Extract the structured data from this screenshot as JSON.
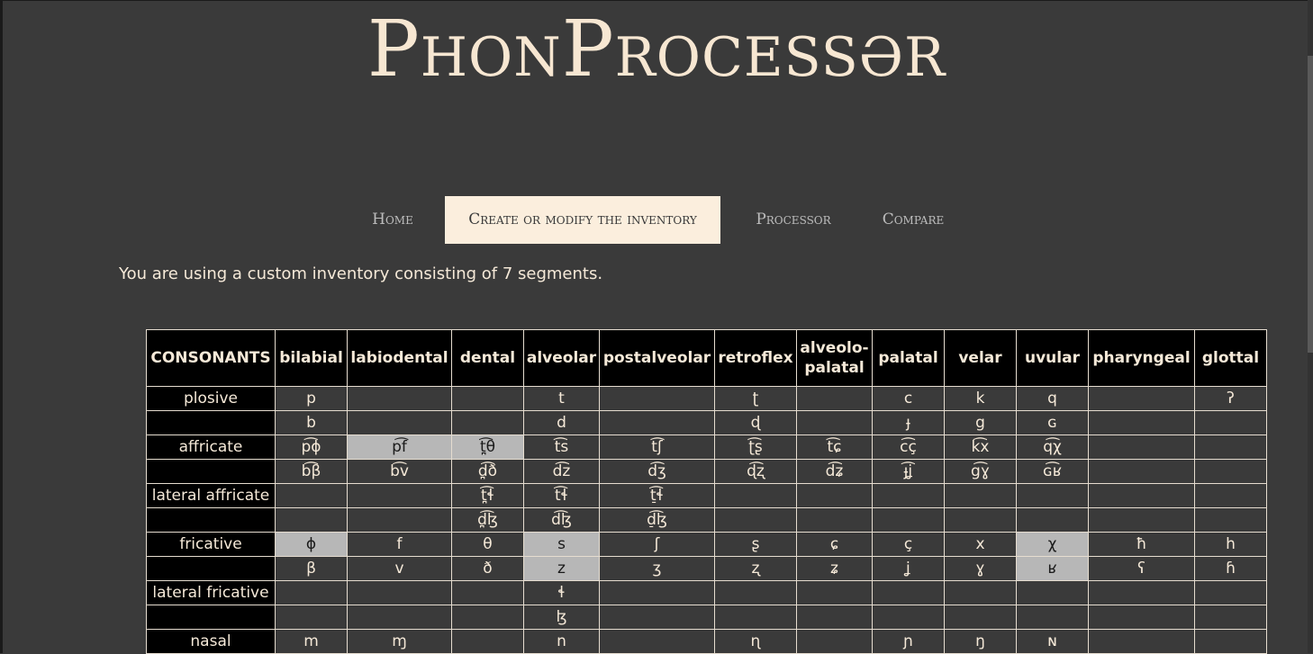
{
  "app": {
    "title": "PhonProcessər"
  },
  "nav": {
    "items": [
      {
        "label": "Home",
        "active": false
      },
      {
        "label": "Create or modify the inventory",
        "active": true
      },
      {
        "label": "Processor",
        "active": false
      },
      {
        "label": "Compare",
        "active": false
      }
    ]
  },
  "info": {
    "text": "You are using a custom inventory consisting of 7 segments."
  },
  "table": {
    "headers": [
      "CONSONANTS",
      "bilabial",
      "labiodental",
      "dental",
      "alveolar",
      "postalveolar",
      "retroflex",
      "alveolo-palatal",
      "palatal",
      "velar",
      "uvular",
      "pharyngeal",
      "glottal"
    ],
    "rows": [
      {
        "label": "plosive",
        "cells": [
          "p",
          "",
          "",
          "t",
          "",
          "ʈ",
          "",
          "c",
          "k",
          "q",
          "",
          "ʔ"
        ],
        "selected": []
      },
      {
        "label": "",
        "cells": [
          "b",
          "",
          "",
          "d",
          "",
          "ɖ",
          "",
          "ɟ",
          "g",
          "ɢ",
          "",
          ""
        ],
        "selected": []
      },
      {
        "label": "affricate",
        "cells": [
          "p͡ɸ",
          "p͡f",
          "t̪͡θ",
          "t͡s",
          "t͡ʃ",
          "ʈ͡ʂ",
          "t͡ɕ",
          "c͡ç",
          "k͡x",
          "q͡χ",
          "",
          ""
        ],
        "selected": [
          1,
          2
        ]
      },
      {
        "label": "",
        "cells": [
          "b͡β",
          "b͡v",
          "d̪͡ð",
          "d͡z",
          "d͡ʒ",
          "ɖ͡ʐ",
          "d͡ʑ",
          "ɟ͡ʝ",
          "g͡ɣ",
          "ɢ͡ʁ",
          "",
          ""
        ],
        "selected": []
      },
      {
        "label": "lateral affricate",
        "cells": [
          "",
          "",
          "t̪͡ɬ",
          "t͡ɬ",
          "t̠͡ɬ",
          "",
          "",
          "",
          "",
          "",
          "",
          ""
        ],
        "selected": []
      },
      {
        "label": "",
        "cells": [
          "",
          "",
          "d̪͡ɮ",
          "d͡ɮ",
          "d̠͡ɮ",
          "",
          "",
          "",
          "",
          "",
          "",
          ""
        ],
        "selected": []
      },
      {
        "label": "fricative",
        "cells": [
          "ɸ",
          "f",
          "θ",
          "s",
          "ʃ",
          "ʂ",
          "ɕ",
          "ç",
          "x",
          "χ",
          "ħ",
          "h"
        ],
        "selected": [
          0,
          3,
          9
        ]
      },
      {
        "label": "",
        "cells": [
          "β",
          "v",
          "ð",
          "z",
          "ʒ",
          "ʐ",
          "ʑ",
          "ʝ",
          "ɣ",
          "ʁ",
          "ʕ",
          "ɦ"
        ],
        "selected": [
          3,
          9
        ]
      },
      {
        "label": "lateral fricative",
        "cells": [
          "",
          "",
          "",
          "ɬ",
          "",
          "",
          "",
          "",
          "",
          "",
          "",
          ""
        ],
        "selected": []
      },
      {
        "label": "",
        "cells": [
          "",
          "",
          "",
          "ɮ",
          "",
          "",
          "",
          "",
          "",
          "",
          "",
          ""
        ],
        "selected": []
      },
      {
        "label": "nasal",
        "cells": [
          "m",
          "ɱ",
          "",
          "n",
          "",
          "ɳ",
          "",
          "ɲ",
          "ŋ",
          "ɴ",
          "",
          ""
        ],
        "selected": []
      }
    ]
  }
}
